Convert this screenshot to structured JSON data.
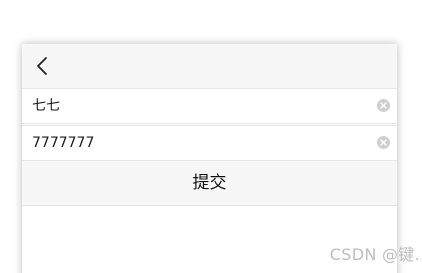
{
  "form": {
    "name_value": "七七",
    "number_value": "7777777",
    "submit_label": "提交"
  },
  "icons": {
    "back": "chevron-left-icon",
    "clear": "clear-circle-icon"
  },
  "watermark": {
    "text": "CSDN @键."
  },
  "colors": {
    "navbar_bg": "#f7f7f7",
    "field_bg": "#ffffff",
    "clear_icon": "#cfcfcf"
  }
}
